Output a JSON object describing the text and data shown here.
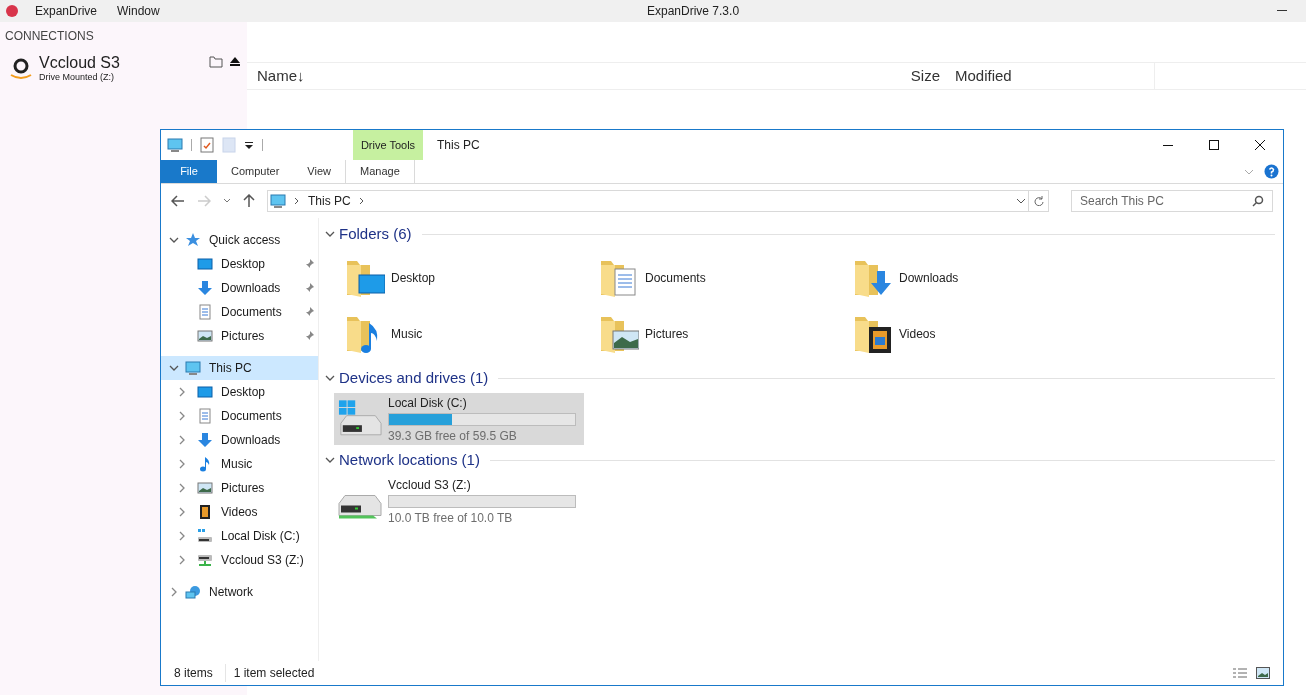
{
  "app": {
    "menu": [
      "ExpanDrive",
      "Window"
    ],
    "title": "ExpanDrive 7.3.0"
  },
  "sidebar": {
    "heading": "CONNECTIONS",
    "connections": [
      {
        "name": "Vccloud S3",
        "status": "Drive Mounted (Z:)"
      }
    ]
  },
  "file_list": {
    "columns": [
      "Name↓",
      "Size",
      "Modified"
    ]
  },
  "explorer": {
    "title": "This PC",
    "context_tab": "Drive Tools",
    "ribbon_tabs": [
      {
        "label": "File",
        "kind": "file"
      },
      {
        "label": "Computer",
        "kind": "tab"
      },
      {
        "label": "View",
        "kind": "tab"
      },
      {
        "label": "Manage",
        "kind": "context"
      }
    ],
    "address": {
      "path": [
        "This PC"
      ]
    },
    "search": {
      "placeholder": "Search This PC"
    },
    "nav": [
      {
        "label": "Quick access",
        "kind": "star",
        "expanded": true,
        "selected": false,
        "children": [
          {
            "label": "Desktop",
            "kind": "desktop",
            "pinned": true,
            "selected": false
          },
          {
            "label": "Downloads",
            "kind": "downloads",
            "pinned": true,
            "selected": false
          },
          {
            "label": "Documents",
            "kind": "documents",
            "pinned": true,
            "selected": false
          },
          {
            "label": "Pictures",
            "kind": "pictures",
            "pinned": true,
            "selected": false
          }
        ]
      },
      {
        "label": "This PC",
        "kind": "pc",
        "expanded": true,
        "selected": true,
        "children": [
          {
            "label": "Desktop",
            "kind": "desktop",
            "expanded": false,
            "selected": false
          },
          {
            "label": "Documents",
            "kind": "documents",
            "expanded": false,
            "selected": false
          },
          {
            "label": "Downloads",
            "kind": "downloads",
            "expanded": false,
            "selected": false
          },
          {
            "label": "Music",
            "kind": "music",
            "expanded": false,
            "selected": false
          },
          {
            "label": "Pictures",
            "kind": "pictures",
            "expanded": false,
            "selected": false
          },
          {
            "label": "Videos",
            "kind": "videos",
            "expanded": false,
            "selected": false
          },
          {
            "label": "Local Disk (C:)",
            "kind": "disk",
            "expanded": false,
            "selected": false
          },
          {
            "label": "Vccloud S3 (Z:)",
            "kind": "netdrive",
            "expanded": false,
            "selected": false
          }
        ]
      },
      {
        "label": "Network",
        "kind": "network",
        "expanded": false,
        "selected": false
      }
    ],
    "sections": [
      {
        "title": "Folders (6)",
        "kind": "folders",
        "expanded": true,
        "items": [
          {
            "label": "Desktop",
            "kind": "desktop"
          },
          {
            "label": "Documents",
            "kind": "documents"
          },
          {
            "label": "Downloads",
            "kind": "downloads"
          },
          {
            "label": "Music",
            "kind": "music"
          },
          {
            "label": "Pictures",
            "kind": "pictures"
          },
          {
            "label": "Videos",
            "kind": "videos"
          }
        ]
      },
      {
        "title": "Devices and drives (1)",
        "kind": "drives",
        "expanded": true,
        "items": [
          {
            "label": "Local Disk (C:)",
            "kind": "disk",
            "level": 0.34,
            "reading": "39.3 GB free of 59.5 GB",
            "selected": true
          }
        ]
      },
      {
        "title": "Network locations (1)",
        "kind": "drives",
        "expanded": true,
        "items": [
          {
            "label": "Vccloud S3 (Z:)",
            "kind": "netdrive",
            "level": 0,
            "reading": "10.0 TB free of 10.0 TB",
            "selected": false
          }
        ]
      }
    ],
    "status": [
      "8 items",
      "1 item selected"
    ]
  }
}
